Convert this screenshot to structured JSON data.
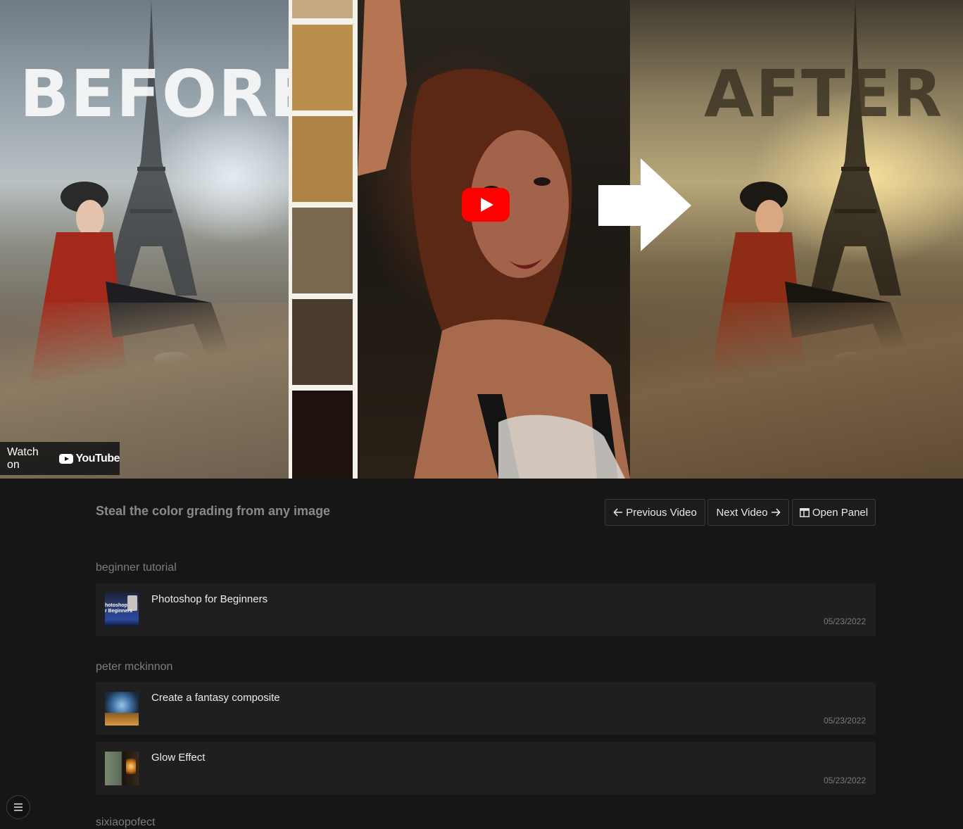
{
  "video": {
    "thumbnail": {
      "before_label": "BEFORE",
      "after_label": "AFTER",
      "swatch_colors": [
        "#c4a882",
        "#b98f4e",
        "#ad8446",
        "#7b6650",
        "#4a3c2f",
        "#1d120d"
      ]
    },
    "watch_on_label": "Watch on",
    "youtube_label": "YouTube"
  },
  "header": {
    "title": "Steal the color grading from any image",
    "prev_label": "Previous Video",
    "next_label": "Next Video",
    "panel_label": "Open Panel"
  },
  "sections": [
    {
      "title": "beginner tutorial",
      "items": [
        {
          "title": "Photoshop for Beginners",
          "date": "05/23/2022",
          "thumb_text": "hotoshop\nr Beginners"
        }
      ]
    },
    {
      "title": "peter mckinnon",
      "items": [
        {
          "title": "Create a fantasy composite",
          "date": "05/23/2022"
        },
        {
          "title": "Glow Effect",
          "date": "05/23/2022"
        }
      ]
    },
    {
      "title": "sixiaopofect"
    }
  ],
  "colors": {
    "page_bg": "#161616",
    "card_bg": "#1f1f1f",
    "play_red": "#ff0000"
  }
}
